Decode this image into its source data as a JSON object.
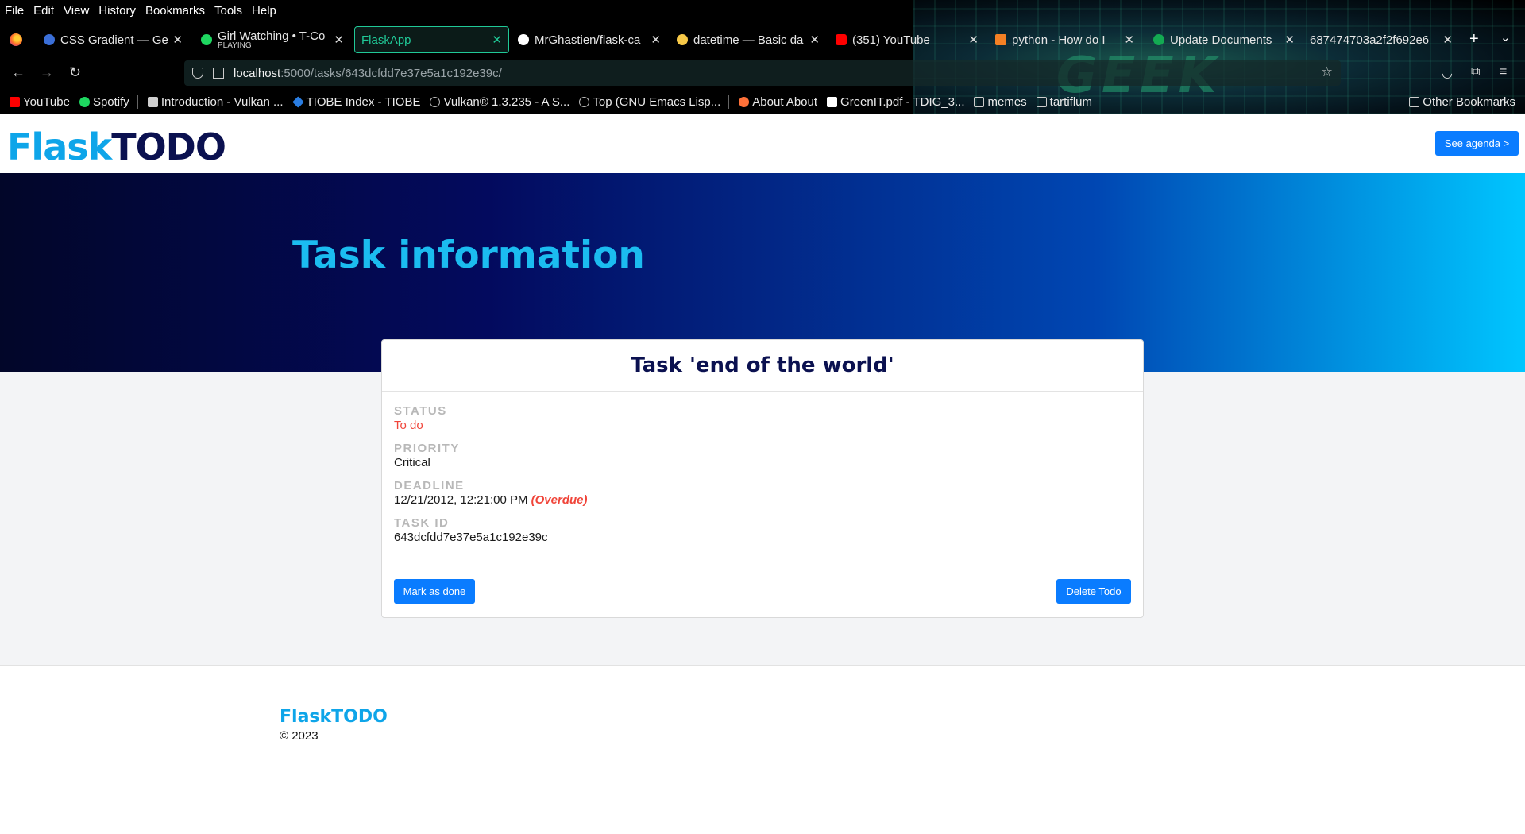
{
  "browser": {
    "menu": [
      "File",
      "Edit",
      "View",
      "History",
      "Bookmarks",
      "Tools",
      "Help"
    ],
    "tabs": [
      {
        "title": "CSS Gradient — Generator",
        "sub": "",
        "color": "#3b6fd8"
      },
      {
        "title": "Girl Watching • T-Co",
        "sub": "PLAYING",
        "color": "#1ed760"
      },
      {
        "title": "FlaskApp",
        "sub": "",
        "color": ""
      },
      {
        "title": "MrGhastien/flask-ca",
        "sub": "",
        "color": "#ffffff"
      },
      {
        "title": "datetime — Basic da",
        "sub": "",
        "color": "#f7c948"
      },
      {
        "title": "(351) YouTube",
        "sub": "",
        "color": "#ff0000"
      },
      {
        "title": "python - How do I",
        "sub": "",
        "color": "#f48024"
      },
      {
        "title": "Update Documents",
        "sub": "",
        "color": "#13aa52"
      },
      {
        "title": "687474703a2f2f692e6",
        "sub": "",
        "color": ""
      }
    ],
    "url_host": "localhost",
    "url_path": ":5000/tasks/643dcfdd7e37e5a1c192e39c/",
    "bookmarks": [
      {
        "label": "YouTube",
        "color": "#ff0000"
      },
      {
        "label": "Spotify",
        "color": "#1ed760"
      },
      {
        "label": "Introduction - Vulkan ...",
        "color": "#cfcfcf"
      },
      {
        "label": "TIOBE Index - TIOBE",
        "color": "#2a7de1"
      },
      {
        "label": "Vulkan® 1.3.235 - A S...",
        "color": "#bbbbbb"
      },
      {
        "label": "Top (GNU Emacs Lisp...",
        "color": "#bbbbbb"
      },
      {
        "label": "About About",
        "color": "#ff7139"
      },
      {
        "label": "GreenIT.pdf - TDIG_3...",
        "color": "#ffffff"
      },
      {
        "label": "memes",
        "color": ""
      },
      {
        "label": "tartiflum",
        "color": ""
      }
    ],
    "other_bookmarks": "Other Bookmarks",
    "wallpaper_text": "GEEK"
  },
  "header": {
    "logo_part1": "Flask",
    "logo_part2": "TODO",
    "agenda_button": "See agenda >"
  },
  "hero": {
    "title": "Task information"
  },
  "task": {
    "heading": "Task 'end of the world'",
    "status_label": "STATUS",
    "status": "To do",
    "priority_label": "PRIORITY",
    "priority": "Critical",
    "deadline_label": "DEADLINE",
    "deadline": "12/21/2012, 12:21:00 PM",
    "overdue": "(Overdue)",
    "id_label": "TASK ID",
    "id": "643dcfdd7e37e5a1c192e39c",
    "mark_done_button": "Mark as done",
    "delete_button": "Delete Todo"
  },
  "footer": {
    "logo": "FlaskTODO",
    "copyright": "© 2023"
  },
  "colors": {
    "accent": "#0a7cff",
    "brand_light": "#0ea5e9",
    "brand_dark": "#0b1150",
    "danger": "#f0453a"
  }
}
